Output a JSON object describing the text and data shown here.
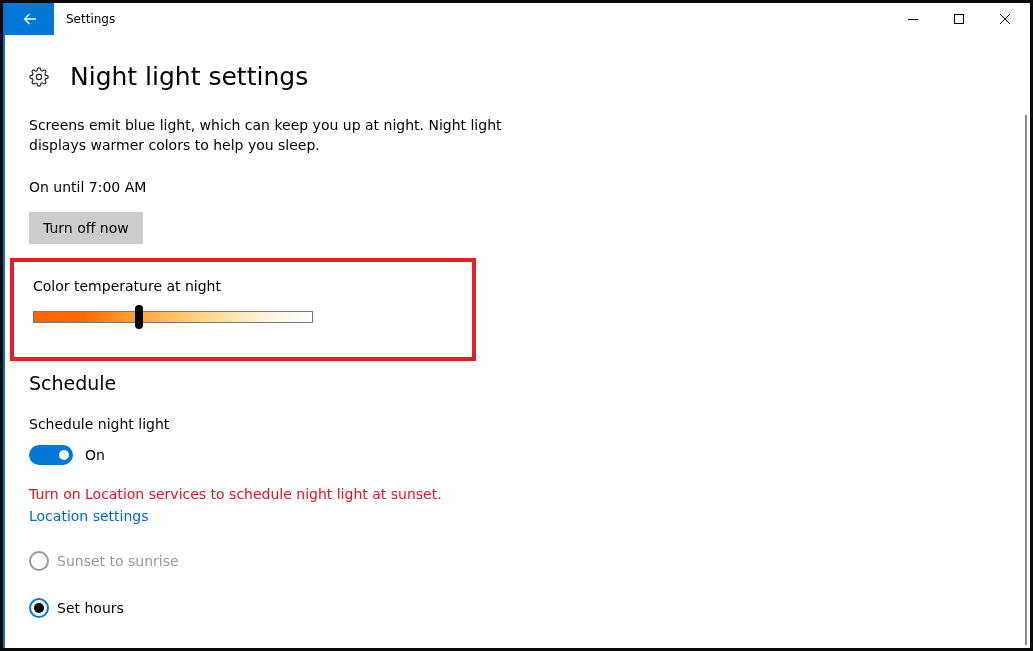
{
  "window": {
    "title": "Settings"
  },
  "page": {
    "title": "Night light settings",
    "description": "Screens emit blue light, which can keep you up at night. Night light displays warmer colors to help you sleep.",
    "status": "On until 7:00 AM",
    "action_button": "Turn off now"
  },
  "color_temperature": {
    "label": "Color temperature at night",
    "level": 0.38,
    "highlighted": true
  },
  "schedule": {
    "heading": "Schedule",
    "toggle_label": "Schedule night light",
    "on": true,
    "state_text": "On",
    "warning": "Turn on Location services to schedule night light at sunset.",
    "link": "Location settings",
    "options": [
      {
        "label": "Sunset to sunrise",
        "selected": false,
        "disabled": true
      },
      {
        "label": "Set hours",
        "selected": true,
        "disabled": false
      }
    ]
  }
}
